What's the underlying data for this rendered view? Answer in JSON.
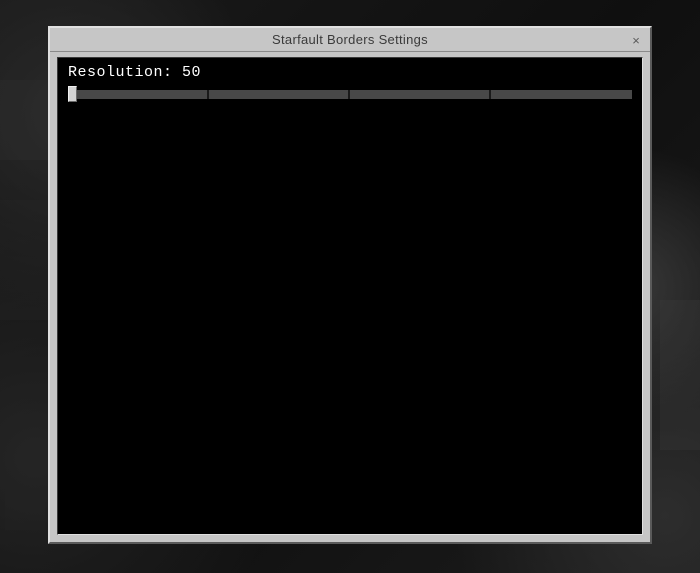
{
  "window": {
    "title": "Starfault Borders Settings",
    "close_glyph": "×"
  },
  "setting": {
    "label_prefix": "Resolution:",
    "value": "50",
    "segments": 4
  }
}
